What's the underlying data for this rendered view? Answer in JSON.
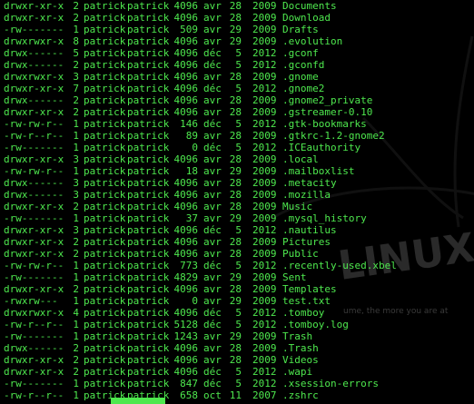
{
  "terminal": {
    "text_color": "#4ee84e",
    "background": "#000000",
    "watermark": {
      "text": "LINUX",
      "tagline": "ume, the more you are at"
    },
    "rows": [
      {
        "perm": "drwxr-xr-x",
        "links": "2",
        "owner": "patrick",
        "group": "patrick",
        "size": "4096",
        "month": "avr",
        "day": "28",
        "year": "2009",
        "name": "Documents"
      },
      {
        "perm": "drwxr-xr-x",
        "links": "2",
        "owner": "patrick",
        "group": "patrick",
        "size": "4096",
        "month": "avr",
        "day": "28",
        "year": "2009",
        "name": "Download"
      },
      {
        "perm": "-rw-------",
        "links": "1",
        "owner": "patrick",
        "group": "patrick",
        "size": "509",
        "month": "avr",
        "day": "29",
        "year": "2009",
        "name": "Drafts"
      },
      {
        "perm": "drwxrwxr-x",
        "links": "8",
        "owner": "patrick",
        "group": "patrick",
        "size": "4096",
        "month": "avr",
        "day": "29",
        "year": "2009",
        "name": ".evolution"
      },
      {
        "perm": "drwx------",
        "links": "5",
        "owner": "patrick",
        "group": "patrick",
        "size": "4096",
        "month": "déc",
        "day": "5",
        "year": "2012",
        "name": ".gconf"
      },
      {
        "perm": "drwx------",
        "links": "2",
        "owner": "patrick",
        "group": "patrick",
        "size": "4096",
        "month": "déc",
        "day": "5",
        "year": "2012",
        "name": ".gconfd"
      },
      {
        "perm": "drwxrwxr-x",
        "links": "3",
        "owner": "patrick",
        "group": "patrick",
        "size": "4096",
        "month": "avr",
        "day": "28",
        "year": "2009",
        "name": ".gnome"
      },
      {
        "perm": "drwxr-xr-x",
        "links": "7",
        "owner": "patrick",
        "group": "patrick",
        "size": "4096",
        "month": "déc",
        "day": "5",
        "year": "2012",
        "name": ".gnome2"
      },
      {
        "perm": "drwx------",
        "links": "2",
        "owner": "patrick",
        "group": "patrick",
        "size": "4096",
        "month": "avr",
        "day": "28",
        "year": "2009",
        "name": ".gnome2_private"
      },
      {
        "perm": "drwxr-xr-x",
        "links": "2",
        "owner": "patrick",
        "group": "patrick",
        "size": "4096",
        "month": "avr",
        "day": "28",
        "year": "2009",
        "name": ".gstreamer-0.10"
      },
      {
        "perm": "-rw-rw-r--",
        "links": "1",
        "owner": "patrick",
        "group": "patrick",
        "size": "146",
        "month": "déc",
        "day": "5",
        "year": "2012",
        "name": ".gtk-bookmarks"
      },
      {
        "perm": "-rw-r--r--",
        "links": "1",
        "owner": "patrick",
        "group": "patrick",
        "size": "89",
        "month": "avr",
        "day": "28",
        "year": "2009",
        "name": ".gtkrc-1.2-gnome2"
      },
      {
        "perm": "-rw-------",
        "links": "1",
        "owner": "patrick",
        "group": "patrick",
        "size": "0",
        "month": "déc",
        "day": "5",
        "year": "2012",
        "name": ".ICEauthority"
      },
      {
        "perm": "drwxr-xr-x",
        "links": "3",
        "owner": "patrick",
        "group": "patrick",
        "size": "4096",
        "month": "avr",
        "day": "28",
        "year": "2009",
        "name": ".local"
      },
      {
        "perm": "-rw-rw-r--",
        "links": "1",
        "owner": "patrick",
        "group": "patrick",
        "size": "18",
        "month": "avr",
        "day": "29",
        "year": "2009",
        "name": ".mailboxlist"
      },
      {
        "perm": "drwx------",
        "links": "3",
        "owner": "patrick",
        "group": "patrick",
        "size": "4096",
        "month": "avr",
        "day": "28",
        "year": "2009",
        "name": ".metacity"
      },
      {
        "perm": "drwx------",
        "links": "3",
        "owner": "patrick",
        "group": "patrick",
        "size": "4096",
        "month": "avr",
        "day": "28",
        "year": "2009",
        "name": ".mozilla"
      },
      {
        "perm": "drwxr-xr-x",
        "links": "2",
        "owner": "patrick",
        "group": "patrick",
        "size": "4096",
        "month": "avr",
        "day": "28",
        "year": "2009",
        "name": "Music"
      },
      {
        "perm": "-rw-------",
        "links": "1",
        "owner": "patrick",
        "group": "patrick",
        "size": "37",
        "month": "avr",
        "day": "29",
        "year": "2009",
        "name": ".mysql_history"
      },
      {
        "perm": "drwxr-xr-x",
        "links": "3",
        "owner": "patrick",
        "group": "patrick",
        "size": "4096",
        "month": "déc",
        "day": "5",
        "year": "2012",
        "name": ".nautilus"
      },
      {
        "perm": "drwxr-xr-x",
        "links": "2",
        "owner": "patrick",
        "group": "patrick",
        "size": "4096",
        "month": "avr",
        "day": "28",
        "year": "2009",
        "name": "Pictures"
      },
      {
        "perm": "drwxr-xr-x",
        "links": "2",
        "owner": "patrick",
        "group": "patrick",
        "size": "4096",
        "month": "avr",
        "day": "28",
        "year": "2009",
        "name": "Public"
      },
      {
        "perm": "-rw-rw-r--",
        "links": "1",
        "owner": "patrick",
        "group": "patrick",
        "size": "773",
        "month": "déc",
        "day": "5",
        "year": "2012",
        "name": ".recently-used.xbel"
      },
      {
        "perm": "-rw-------",
        "links": "1",
        "owner": "patrick",
        "group": "patrick",
        "size": "4829",
        "month": "avr",
        "day": "29",
        "year": "2009",
        "name": "Sent"
      },
      {
        "perm": "drwxr-xr-x",
        "links": "2",
        "owner": "patrick",
        "group": "patrick",
        "size": "4096",
        "month": "avr",
        "day": "28",
        "year": "2009",
        "name": "Templates"
      },
      {
        "perm": "-rwxrw---",
        "links": "1",
        "owner": "patrick",
        "group": "patrick",
        "size": "0",
        "month": "avr",
        "day": "29",
        "year": "2009",
        "name": "test.txt"
      },
      {
        "perm": "drwxrwxr-x",
        "links": "4",
        "owner": "patrick",
        "group": "patrick",
        "size": "4096",
        "month": "déc",
        "day": "5",
        "year": "2012",
        "name": ".tomboy"
      },
      {
        "perm": "-rw-r--r--",
        "links": "1",
        "owner": "patrick",
        "group": "patrick",
        "size": "5128",
        "month": "déc",
        "day": "5",
        "year": "2012",
        "name": ".tomboy.log"
      },
      {
        "perm": "-rw-------",
        "links": "1",
        "owner": "patrick",
        "group": "patrick",
        "size": "1243",
        "month": "avr",
        "day": "29",
        "year": "2009",
        "name": "Trash"
      },
      {
        "perm": "drwx------",
        "links": "2",
        "owner": "patrick",
        "group": "patrick",
        "size": "4096",
        "month": "avr",
        "day": "28",
        "year": "2009",
        "name": ".Trash"
      },
      {
        "perm": "drwxr-xr-x",
        "links": "2",
        "owner": "patrick",
        "group": "patrick",
        "size": "4096",
        "month": "avr",
        "day": "28",
        "year": "2009",
        "name": "Videos"
      },
      {
        "perm": "drwxr-xr-x",
        "links": "2",
        "owner": "patrick",
        "group": "patrick",
        "size": "4096",
        "month": "déc",
        "day": "5",
        "year": "2012",
        "name": ".wapi"
      },
      {
        "perm": "-rw-------",
        "links": "1",
        "owner": "patrick",
        "group": "patrick",
        "size": "847",
        "month": "déc",
        "day": "5",
        "year": "2012",
        "name": ".xsession-errors"
      },
      {
        "perm": "-rw-r--r--",
        "links": "1",
        "owner": "patrick",
        "group": "patrick",
        "size": "658",
        "month": "oct",
        "day": "11",
        "year": "2007",
        "name": ".zshrc"
      }
    ]
  }
}
